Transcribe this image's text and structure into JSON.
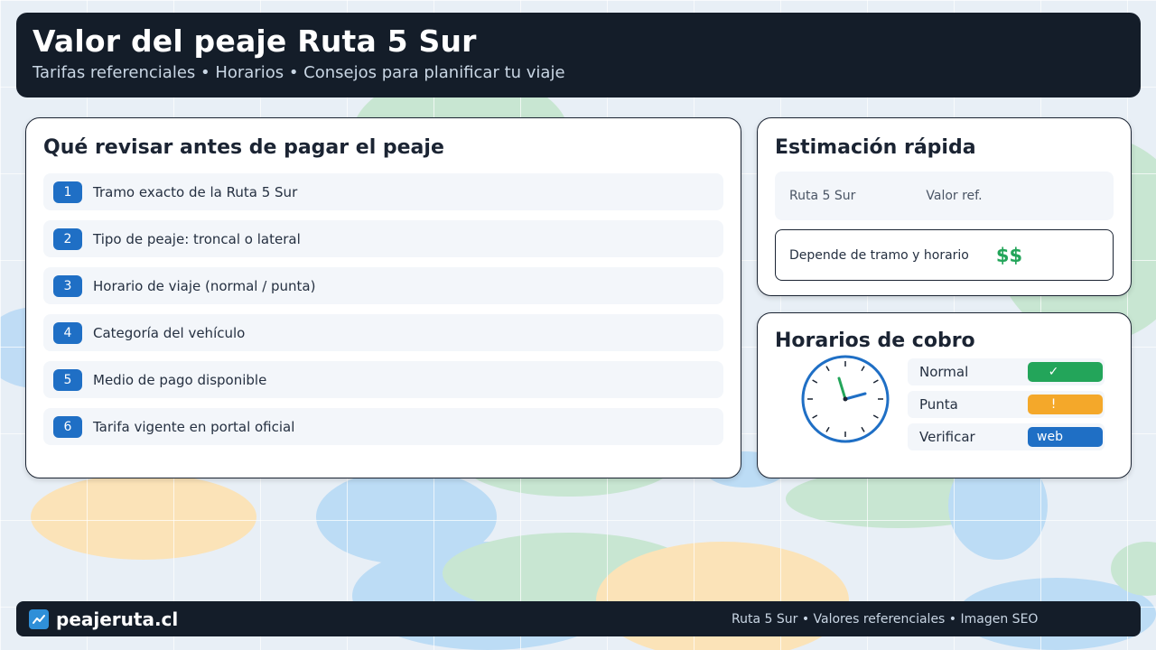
{
  "header": {
    "title": "Valor del peaje Ruta 5 Sur",
    "subtitle": "Tarifas referenciales • Horarios • Consejos para planificar tu viaje"
  },
  "checklist": {
    "title": "Qué revisar antes de pagar el peaje",
    "items": [
      {
        "num": "1",
        "label": "Tramo exacto de la Ruta 5 Sur"
      },
      {
        "num": "2",
        "label": "Tipo de peaje: troncal o lateral"
      },
      {
        "num": "3",
        "label": "Horario de viaje (normal / punta)"
      },
      {
        "num": "4",
        "label": "Categoría del vehículo"
      },
      {
        "num": "5",
        "label": "Medio de pago disponible"
      },
      {
        "num": "6",
        "label": "Tarifa vigente en portal oficial"
      }
    ]
  },
  "estimate": {
    "title": "Estimación rápida",
    "col1": "Ruta 5 Sur",
    "col2": "Valor ref.",
    "note": "Depende de tramo y horario",
    "price_symbol": "$$"
  },
  "schedule": {
    "title": "Horarios de cobro",
    "clock_icon": "clock-icon",
    "rows": [
      {
        "label": "Normal",
        "badge": "✓",
        "color": "#23a55a"
      },
      {
        "label": "Punta",
        "badge": "!",
        "color": "#f4a82a"
      },
      {
        "label": "Verificar",
        "badge": "web",
        "color": "#1f6fc5"
      }
    ]
  },
  "footer": {
    "brand": "peajeruta.cl",
    "logo_icon": "chart-line-icon",
    "note": "Ruta 5 Sur • Valores referenciales • Imagen SEO"
  },
  "colors": {
    "dark": "#141d29",
    "accent_blue": "#1f6fc5",
    "accent_green": "#23a55a",
    "accent_orange": "#f4a82a"
  }
}
